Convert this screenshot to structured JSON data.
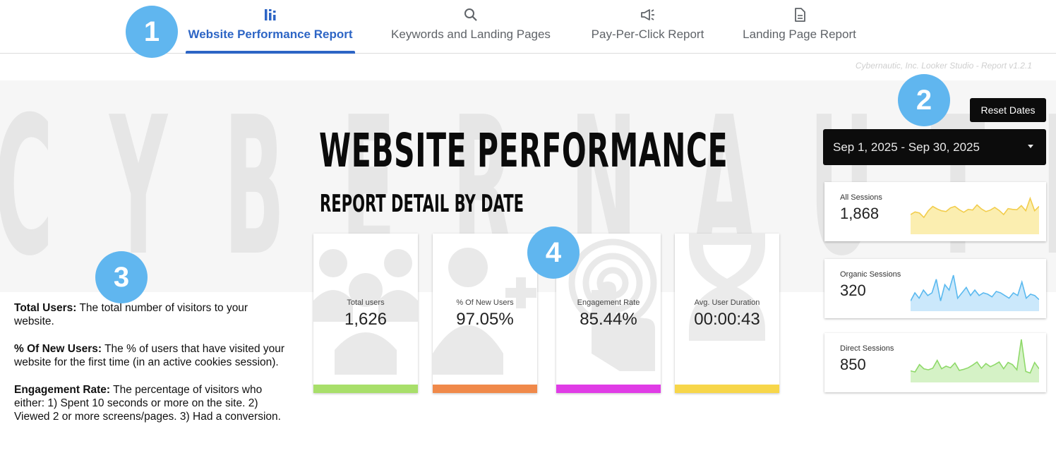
{
  "nav": {
    "tabs": [
      {
        "label": "Website Performance Report",
        "icon": "bar-chart-icon",
        "active": true
      },
      {
        "label": "Keywords and Landing Pages",
        "icon": "search-icon",
        "active": false
      },
      {
        "label": "Pay-Per-Click Report",
        "icon": "megaphone-icon",
        "active": false
      },
      {
        "label": "Landing Page Report",
        "icon": "document-icon",
        "active": false
      }
    ]
  },
  "badges": [
    "1",
    "2",
    "3",
    "4"
  ],
  "version": "Cybernautic, Inc. Looker Studio - Report v1.2.1",
  "watermark": "CYBERNAUTIC",
  "headline": "WEBSITE PERFORMANCE",
  "subhead": "REPORT DETAIL BY DATE",
  "controls": {
    "reset_label": "Reset Dates",
    "date_range": "Sep 1, 2025 - Sep 30, 2025"
  },
  "kpis": [
    {
      "label": "Total users",
      "value": "1,626",
      "color": "#a8df6a",
      "icon": "users-icon"
    },
    {
      "label": "% Of New Users",
      "value": "97.05%",
      "color": "#f0894a",
      "icon": "add-user-icon"
    },
    {
      "label": "Engagement Rate",
      "value": "85.44%",
      "color": "#e03ce6",
      "icon": "tap-target-icon"
    },
    {
      "label": "Avg. User Duration",
      "value": "00:00:43",
      "color": "#f7d64a",
      "icon": "hourglass-icon"
    }
  ],
  "sparklines": [
    {
      "label": "All Sessions",
      "value": "1,868",
      "stroke": "#f2cd4d",
      "fill": "#fbeeb0",
      "points": [
        48,
        55,
        52,
        40,
        58,
        70,
        63,
        58,
        56,
        66,
        70,
        61,
        54,
        62,
        60,
        74,
        63,
        56,
        60,
        67,
        59,
        48,
        64,
        62,
        61,
        72,
        58,
        92,
        58,
        70
      ]
    },
    {
      "label": "Organic Sessions",
      "value": "320",
      "stroke": "#5ab9ef",
      "fill": "#cbe8fb",
      "points": [
        6,
        12,
        8,
        14,
        10,
        12,
        22,
        6,
        18,
        14,
        25,
        8,
        12,
        16,
        10,
        14,
        10,
        12,
        11,
        9,
        13,
        12,
        10,
        8,
        12,
        10,
        20,
        8,
        11,
        10,
        7
      ]
    },
    {
      "label": "Direct Sessions",
      "value": "850",
      "stroke": "#8fd96a",
      "fill": "#d5f2c6",
      "points": [
        18,
        16,
        30,
        22,
        20,
        23,
        38,
        22,
        27,
        24,
        33,
        19,
        21,
        24,
        29,
        35,
        23,
        32,
        26,
        30,
        35,
        22,
        34,
        30,
        20,
        78,
        17,
        14,
        34,
        22
      ]
    }
  ],
  "definitions": [
    {
      "term": "Total Users:",
      "text": " The total number of visitors to your website."
    },
    {
      "term": "% Of New Users:",
      "text": " The % of users that have visited your website for the first time (in an active cookies session)."
    },
    {
      "term": "Engagement Rate:",
      "text": " The percentage of visitors who either: 1) Spent 10 seconds or more on the site. 2) Viewed 2 or more screens/pages. 3) Had a conversion."
    }
  ],
  "colors": {
    "accent": "#2d65c5",
    "badge": "#60b6ef"
  }
}
